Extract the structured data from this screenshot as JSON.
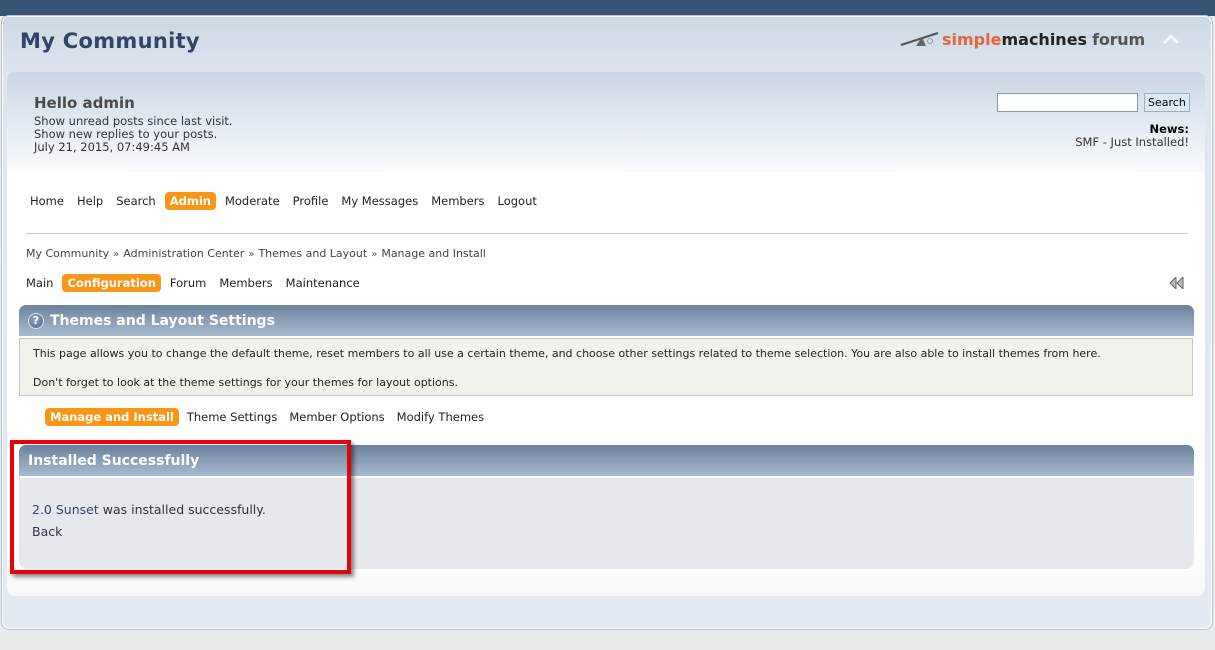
{
  "header": {
    "forum_title": "My Community",
    "logo": {
      "part1": "simple",
      "part2": "machines",
      "part3": "forum"
    },
    "collapse_icon": "chevron-up-icon"
  },
  "user": {
    "greeting": "Hello admin",
    "links": [
      "Show unread posts since last visit.",
      "Show new replies to your posts."
    ],
    "datetime": "July 21, 2015, 07:49:45 AM"
  },
  "search": {
    "value": "",
    "placeholder": "",
    "button_label": "Search"
  },
  "news": {
    "title": "News:",
    "text": "SMF - Just Installed!"
  },
  "menu": {
    "items": [
      {
        "label": "Home",
        "active": false
      },
      {
        "label": "Help",
        "active": false
      },
      {
        "label": "Search",
        "active": false
      },
      {
        "label": "Admin",
        "active": true
      },
      {
        "label": "Moderate",
        "active": false
      },
      {
        "label": "Profile",
        "active": false
      },
      {
        "label": "My Messages",
        "active": false
      },
      {
        "label": "Members",
        "active": false
      },
      {
        "label": "Logout",
        "active": false
      }
    ]
  },
  "breadcrumb": {
    "separator": "»",
    "items": [
      "My Community",
      "Administration Center",
      "Themes and Layout",
      "Manage and Install"
    ]
  },
  "admin_tabs": {
    "items": [
      {
        "label": "Main",
        "active": false
      },
      {
        "label": "Configuration",
        "active": true
      },
      {
        "label": "Forum",
        "active": false
      },
      {
        "label": "Members",
        "active": false
      },
      {
        "label": "Maintenance",
        "active": false
      }
    ],
    "sidebar_toggle_icon": "double-chevron-left-icon"
  },
  "settings_section": {
    "title": "Themes and Layout Settings",
    "help_icon": "question-mark-icon",
    "description": [
      "This page allows you to change the default theme, reset members to all use a certain theme, and choose other settings related to theme selection. You are also able to install themes from here.",
      "Don't forget to look at the theme settings for your themes for layout options."
    ]
  },
  "sub_tabs": {
    "items": [
      {
        "label": "Manage and Install",
        "active": true
      },
      {
        "label": "Theme Settings",
        "active": false
      },
      {
        "label": "Member Options",
        "active": false
      },
      {
        "label": "Modify Themes",
        "active": false
      }
    ]
  },
  "result": {
    "title": "Installed Successfully",
    "theme_link": "2.0 Sunset",
    "message_suffix": " was installed successfully.",
    "back_label": "Back"
  },
  "colors": {
    "accent": "#f99617",
    "highlight_box": "#e8000a",
    "top_band": "#365473",
    "header_gradient_top": "#6b829c",
    "header_gradient_bottom": "#a9bbd0"
  }
}
